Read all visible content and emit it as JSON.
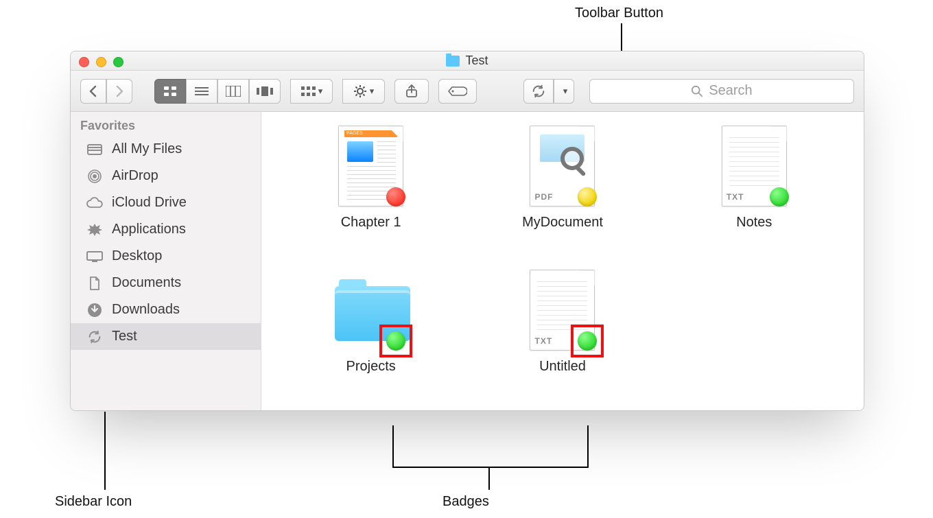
{
  "annotations": {
    "toolbar_button": "Toolbar Button",
    "sidebar_icon": "Sidebar Icon",
    "badges": "Badges"
  },
  "window": {
    "title": "Test"
  },
  "toolbar": {
    "search_placeholder": "Search"
  },
  "sidebar": {
    "heading": "Favorites",
    "items": [
      {
        "label": "All My Files",
        "icon": "all-my-files-icon",
        "selected": false
      },
      {
        "label": "AirDrop",
        "icon": "airdrop-icon",
        "selected": false
      },
      {
        "label": "iCloud Drive",
        "icon": "icloud-drive-icon",
        "selected": false
      },
      {
        "label": "Applications",
        "icon": "applications-icon",
        "selected": false
      },
      {
        "label": "Desktop",
        "icon": "desktop-icon",
        "selected": false
      },
      {
        "label": "Documents",
        "icon": "documents-icon",
        "selected": false
      },
      {
        "label": "Downloads",
        "icon": "downloads-icon",
        "selected": false
      },
      {
        "label": "Test",
        "icon": "sync-icon",
        "selected": true
      }
    ]
  },
  "files": [
    {
      "name": "Chapter 1",
      "kind": "pages",
      "badge": "red",
      "highlight": false
    },
    {
      "name": "MyDocument",
      "kind": "pdf",
      "badge": "yellow",
      "highlight": false
    },
    {
      "name": "Notes",
      "kind": "txt",
      "badge": "green",
      "highlight": false
    },
    {
      "name": "Projects",
      "kind": "folder",
      "badge": "green",
      "highlight": true
    },
    {
      "name": "Untitled",
      "kind": "txt",
      "badge": "green",
      "highlight": true
    }
  ],
  "file_type_tags": {
    "pdf": "PDF",
    "txt": "TXT",
    "pages": "PAGES"
  }
}
